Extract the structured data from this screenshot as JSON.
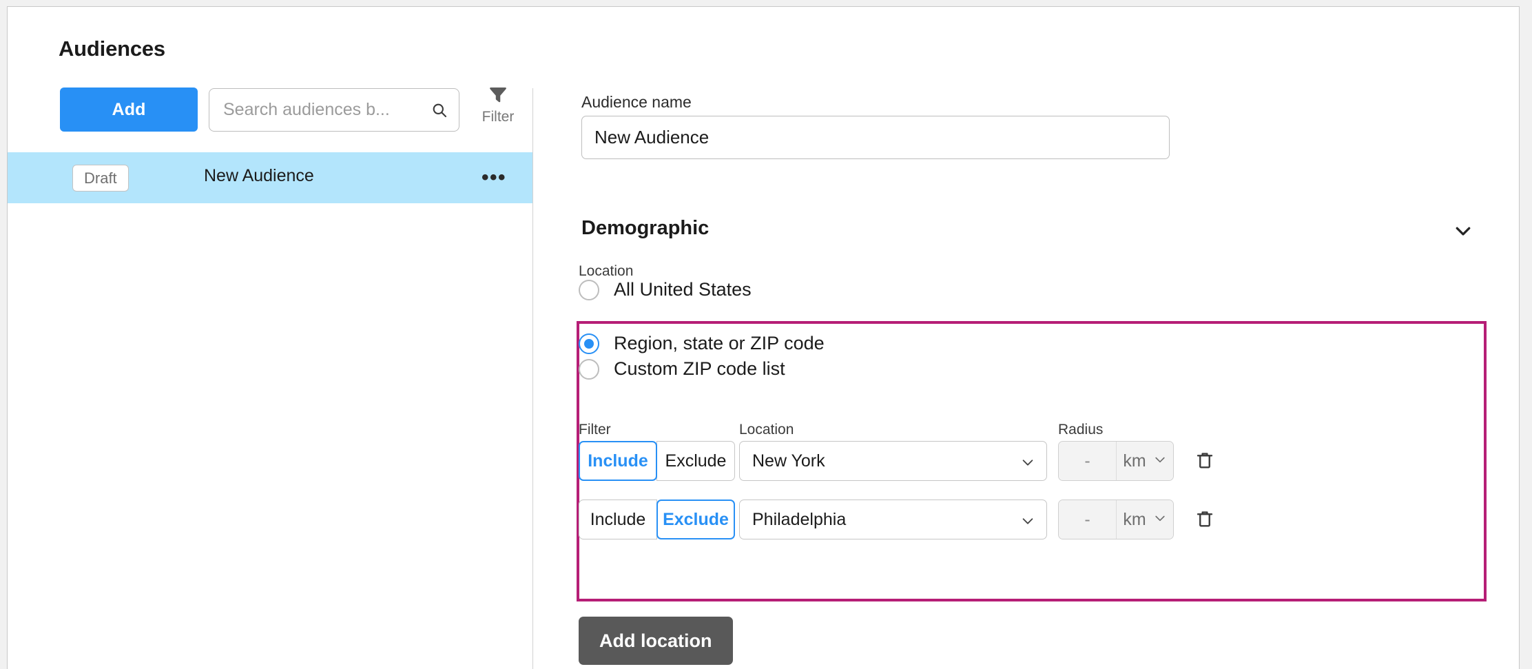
{
  "sidebar": {
    "title": "Audiences",
    "add_label": "Add",
    "search": {
      "placeholder": "Search audiences b...",
      "value": "",
      "icon": "search-icon"
    },
    "filter": {
      "label": "Filter",
      "icon": "funnel-icon"
    },
    "rows": [
      {
        "status": "Draft",
        "name": "New Audience",
        "menu": "•••",
        "selected": true
      }
    ]
  },
  "detail": {
    "audience_name": {
      "label": "Audience name",
      "value": "New Audience",
      "placeholder": "Audience name"
    },
    "demographic": {
      "title": "Demographic",
      "chevron_icon": "chevron-down-icon",
      "expanded": true
    },
    "location": {
      "label": "Location",
      "options": [
        {
          "label": "All United States",
          "selected": false
        },
        {
          "label": "Region, state or ZIP code",
          "selected": true
        },
        {
          "label": "Custom ZIP code list",
          "selected": false
        }
      ],
      "column_headers": {
        "filter": "Filter",
        "location": "Location",
        "radius": "Radius"
      },
      "rows": [
        {
          "include_label": "Include",
          "exclude_label": "Exclude",
          "mode": "Include",
          "location_value": "New York",
          "radius_value": "-",
          "radius_placeholder": "-",
          "radius_unit": "km",
          "delete_icon": "trash-icon"
        },
        {
          "include_label": "Include",
          "exclude_label": "Exclude",
          "mode": "Exclude",
          "location_value": "Philadelphia",
          "radius_value": "-",
          "radius_placeholder": "-",
          "radius_unit": "km",
          "delete_icon": "trash-icon"
        }
      ],
      "add_location_label": "Add location"
    }
  },
  "colors": {
    "accent_blue": "#2890f5",
    "highlight_magenta": "#b61e76",
    "selected_row_blue": "#b3e5fc",
    "dark_button": "#595959"
  }
}
